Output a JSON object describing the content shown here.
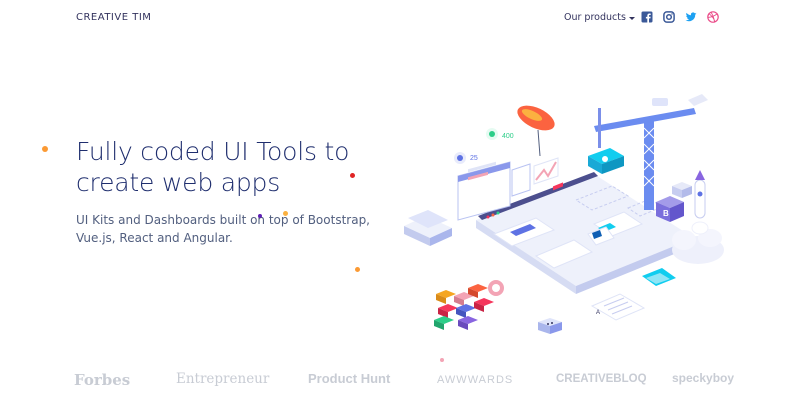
{
  "nav": {
    "brand": "CREATIVE TIM",
    "products_label": "Our products",
    "social_icons": [
      "facebook-icon",
      "instagram-icon",
      "twitter-icon",
      "dribbble-icon"
    ]
  },
  "hero": {
    "headline_line1": "Fully coded UI Tools to",
    "headline_line2": "create web apps",
    "subtitle_line1": "UI Kits and Dashboards built on top of Bootstrap,",
    "subtitle_line2": "Vue.js, React and Angular."
  },
  "illustration": {
    "badge_left": "25",
    "badge_right": "400"
  },
  "press": [
    "Forbes",
    "Entrepreneur",
    "Product Hunt",
    "AWWWARDS",
    "CREATIVEBLOQ",
    "speckyboy"
  ],
  "colors": {
    "headline": "#1f2e6e",
    "body_text": "#525f7f",
    "press_gray": "#c8ccd4",
    "accent_blue": "#5e72e4",
    "facebook": "#3b5998",
    "instagram": "#3b5998",
    "twitter": "#1da1f2",
    "dribbble": "#ea4c89"
  }
}
